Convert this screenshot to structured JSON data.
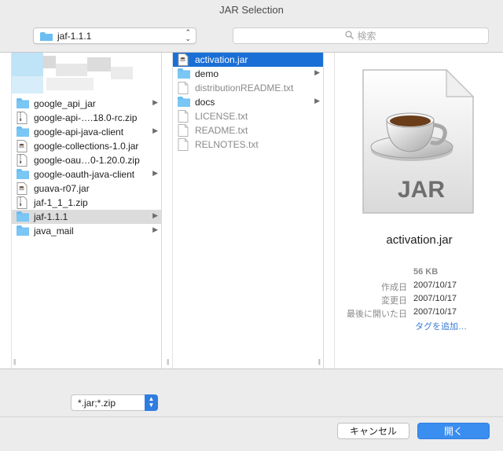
{
  "window": {
    "title": "JAR Selection"
  },
  "toolbar": {
    "location": "jaf-1.1.1",
    "search_placeholder": "検索"
  },
  "column1": {
    "items": [
      {
        "label": "google_api_jar",
        "kind": "folder",
        "chevron": true
      },
      {
        "label": "google-api-….18.0-rc.zip",
        "kind": "zip",
        "chevron": false
      },
      {
        "label": "google-api-java-client",
        "kind": "folder",
        "chevron": true
      },
      {
        "label": "google-collections-1.0.jar",
        "kind": "jar",
        "chevron": false
      },
      {
        "label": "google-oau…0-1.20.0.zip",
        "kind": "zip",
        "chevron": false
      },
      {
        "label": "google-oauth-java-client",
        "kind": "folder",
        "chevron": true
      },
      {
        "label": "guava-r07.jar",
        "kind": "jar",
        "chevron": false
      },
      {
        "label": "jaf-1_1_1.zip",
        "kind": "zip",
        "chevron": false
      },
      {
        "label": "jaf-1.1.1",
        "kind": "folder",
        "chevron": true,
        "selected": true
      },
      {
        "label": "java_mail",
        "kind": "folder",
        "chevron": true
      }
    ]
  },
  "column2": {
    "items": [
      {
        "label": "activation.jar",
        "kind": "jar",
        "chevron": false,
        "selected": true
      },
      {
        "label": "demo",
        "kind": "folder",
        "chevron": true
      },
      {
        "label": "distributionREADME.txt",
        "kind": "txt",
        "chevron": false,
        "dim": true
      },
      {
        "label": "docs",
        "kind": "folder",
        "chevron": true
      },
      {
        "label": "LICENSE.txt",
        "kind": "txt",
        "chevron": false,
        "dim": true
      },
      {
        "label": "README.txt",
        "kind": "txt",
        "chevron": false,
        "dim": true
      },
      {
        "label": "RELNOTES.txt",
        "kind": "txt",
        "chevron": false,
        "dim": true
      }
    ]
  },
  "preview": {
    "icon_text": "JAR",
    "name": "activation.jar",
    "size": "56 KB",
    "created_label": "作成日",
    "created": "2007/10/17",
    "modified_label": "変更日",
    "modified": "2007/10/17",
    "opened_label": "最後に開いた日",
    "opened": "2007/10/17",
    "add_tags": "タグを追加…"
  },
  "format": {
    "value": "*.jar;*.zip"
  },
  "buttons": {
    "cancel": "キャンセル",
    "open": "開く"
  },
  "colors": {
    "accent": "#1a6fd6",
    "folder": "#6cbdf1",
    "link": "#3a7bd5"
  }
}
